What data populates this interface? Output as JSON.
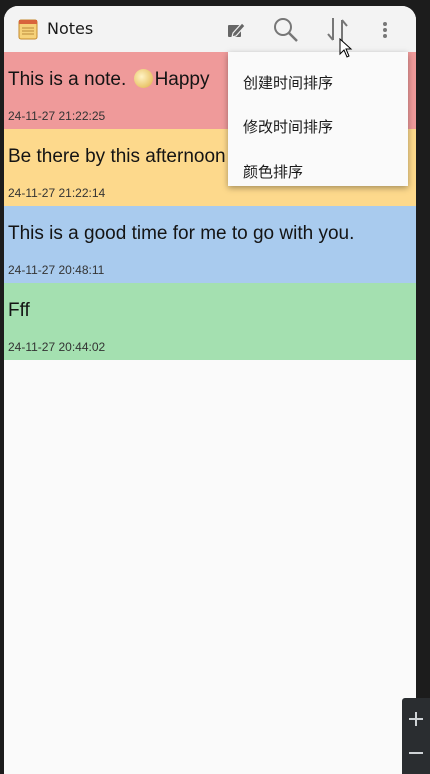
{
  "app": {
    "title": "Notes"
  },
  "toolbar": {
    "icons": [
      "new-note-icon",
      "search-icon",
      "sort-icon",
      "overflow-menu-icon"
    ]
  },
  "notes": [
    {
      "text": "This is a note.",
      "text_after_emoji": "Happy",
      "emoji": "moon-emoji",
      "time": "24-11-27 21:22:25",
      "color": "#ef9a9a"
    },
    {
      "text": "Be there by this afternoon",
      "time": "24-11-27 21:22:14",
      "color": "#fdd98c"
    },
    {
      "text": "This is a good time for me to go with you.",
      "time": "24-11-27 20:48:11",
      "color": "#a9cbee"
    },
    {
      "text": "Fff",
      "time": "24-11-27 20:44:02",
      "color": "#a4e0b0"
    }
  ],
  "sort_menu": {
    "items": [
      "创建时间排序",
      "修改时间排序",
      "颜色排序"
    ]
  },
  "side_panel": {
    "icons": [
      "plus-icon",
      "minus-icon"
    ]
  }
}
